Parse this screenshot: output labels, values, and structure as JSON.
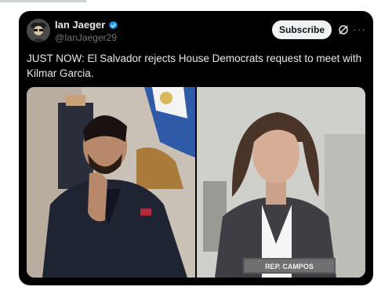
{
  "post": {
    "author_name": "Ian Jaeger",
    "author_handle": "@IanJaeger29",
    "subscribe_label": "Subscribe",
    "more_label": "···",
    "text": "JUST NOW: El Salvador rejects House Democrats request to meet with Kilmar Garcia.",
    "verified_icon": "verified-badge-icon",
    "grok_icon": "grok-icon"
  },
  "media": {
    "nameplate_text": "REP. CAMPOS"
  },
  "colors": {
    "card_background": "#000000",
    "primary_text": "#e7e9ea",
    "secondary_text": "#71767b",
    "verified_blue": "#1d9bf0",
    "subscribe_bg": "#eff3f4"
  }
}
